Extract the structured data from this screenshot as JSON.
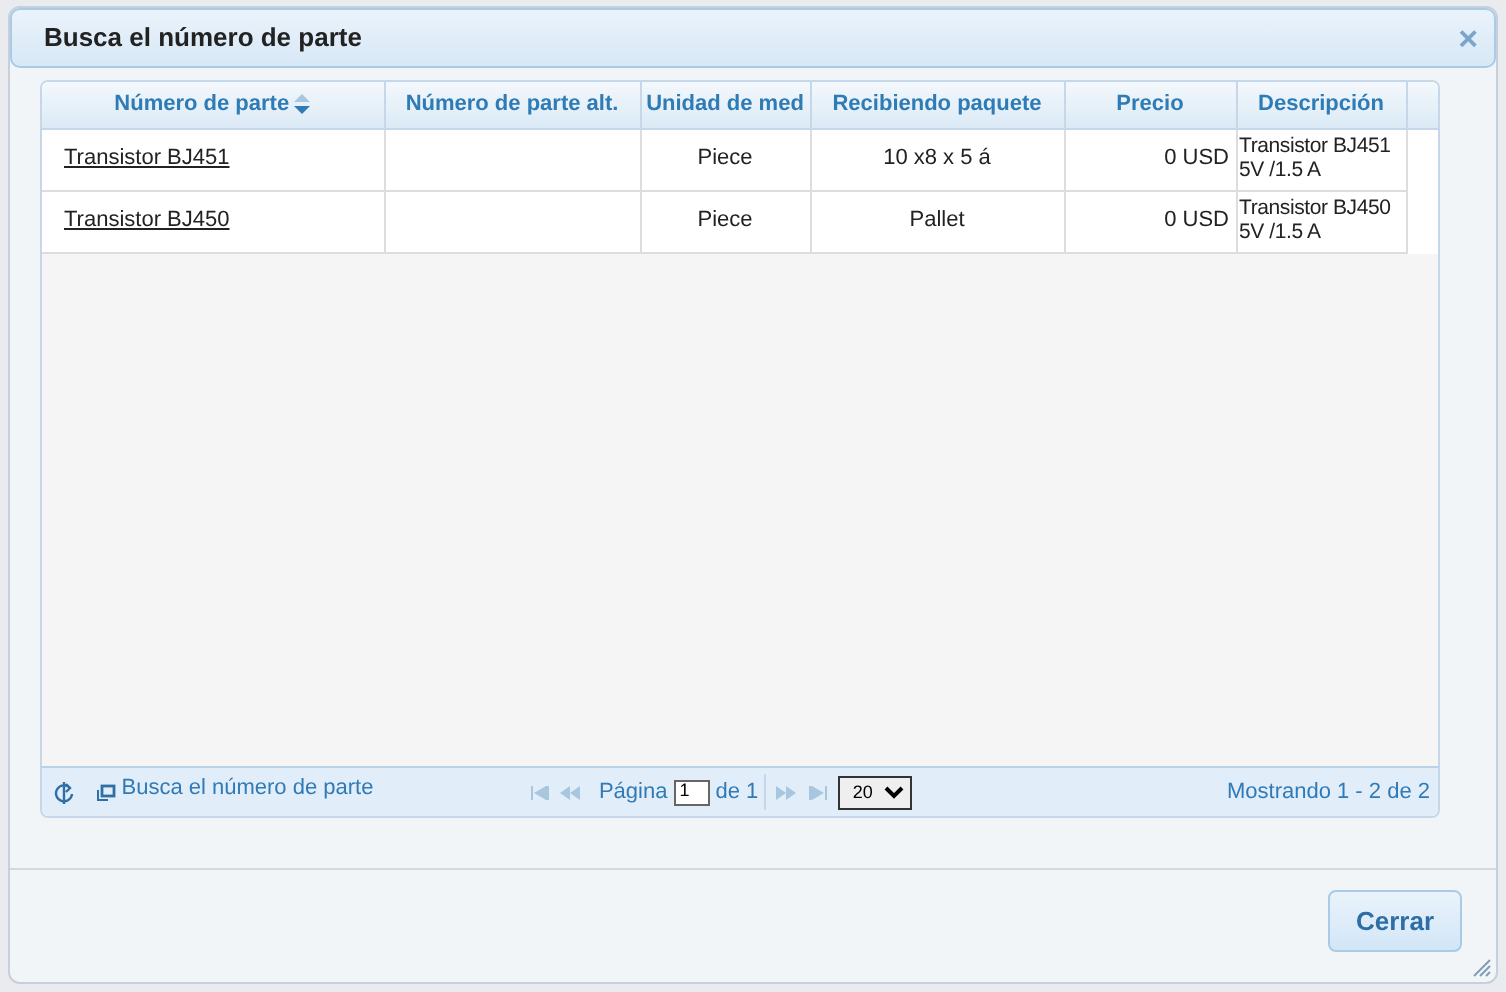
{
  "dialog": {
    "title": "Busca el número de parte",
    "close": "×"
  },
  "grid": {
    "columns": [
      {
        "label": "Número de parte",
        "sorted": true
      },
      {
        "label": "Número de parte alt.",
        "sorted": false
      },
      {
        "label": "Unidad de med",
        "sorted": false
      },
      {
        "label": "Recibiendo paquete",
        "sorted": false
      },
      {
        "label": "Precio",
        "sorted": false
      },
      {
        "label": "Descripción",
        "sorted": false
      }
    ],
    "rows": [
      {
        "part": "Transistor BJ451",
        "alt_part": "",
        "unit": "Piece",
        "package": "10 x8 x 5 á",
        "price": "0 USD",
        "description": "Transistor BJ451 5V /1.5 A"
      },
      {
        "part": "Transistor BJ450",
        "alt_part": "",
        "unit": "Piece",
        "package": "Pallet",
        "price": "0 USD",
        "description": "Transistor BJ450 5V /1.5 A"
      }
    ]
  },
  "pager": {
    "caption": "Busca el número de parte",
    "page_label": "Página",
    "page": "1",
    "of_label": "de 1",
    "page_size": "20",
    "summary": "Mostrando 1 - 2 de 2"
  },
  "buttons": [
    "Cerrar"
  ]
}
